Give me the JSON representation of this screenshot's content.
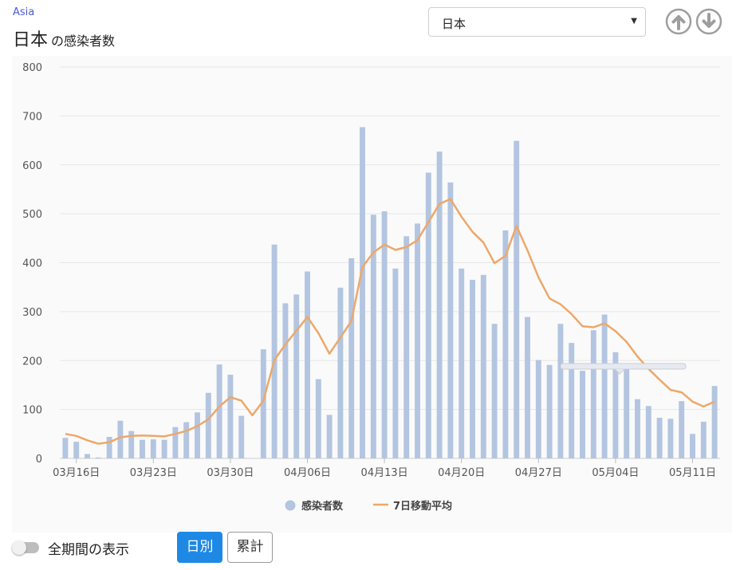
{
  "header": {
    "region": "Asia",
    "title": "日本",
    "subtitle": "の感染者数"
  },
  "country_select": {
    "value": "日本"
  },
  "icons": {
    "up": "arrow-up-circle-icon",
    "down": "arrow-down-circle-icon",
    "dropdown": "caret-down-icon"
  },
  "controls": {
    "toggle_label": "全期間の表示",
    "toggle_on": false,
    "daily_label": "日別",
    "cumulative_label": "累計"
  },
  "colors": {
    "bars": "#b3c5e0",
    "line": "#eda86a",
    "accent": "#1e88e5",
    "region": "#4a5bd6"
  },
  "chart_data": {
    "type": "bar",
    "x": [
      "03月15日",
      "03月16日",
      "03月17日",
      "03月18日",
      "03月19日",
      "03月20日",
      "03月21日",
      "03月22日",
      "03月23日",
      "03月24日",
      "03月25日",
      "03月26日",
      "03月27日",
      "03月28日",
      "03月29日",
      "03月30日",
      "03月31日",
      "04月01日",
      "04月02日",
      "04月03日",
      "04月04日",
      "04月05日",
      "04月06日",
      "04月07日",
      "04月08日",
      "04月09日",
      "04月10日",
      "04月11日",
      "04月12日",
      "04月13日",
      "04月14日",
      "04月15日",
      "04月16日",
      "04月17日",
      "04月18日",
      "04月19日",
      "04月20日",
      "04月21日",
      "04月22日",
      "04月23日",
      "04月24日",
      "04月25日",
      "04月26日",
      "04月27日",
      "04月28日",
      "04月29日",
      "04月30日",
      "05月01日",
      "05月02日",
      "05月03日",
      "05月04日",
      "05月05日",
      "05月06日",
      "05月07日",
      "05月08日",
      "05月09日",
      "05月10日",
      "05月11日",
      "05月12日",
      "05月13日"
    ],
    "x_ticks": [
      "03月16日",
      "03月23日",
      "03月30日",
      "04月06日",
      "04月13日",
      "04月20日",
      "04月27日",
      "05月04日",
      "05月11日"
    ],
    "series": [
      {
        "name": "感染者数",
        "kind": "bar",
        "values": [
          42,
          34,
          9,
          2,
          44,
          77,
          56,
          38,
          39,
          38,
          64,
          74,
          94,
          134,
          192,
          171,
          87,
          0,
          223,
          437,
          317,
          335,
          382,
          162,
          89,
          349,
          409,
          677,
          498,
          505,
          388,
          454,
          480,
          584,
          627,
          564,
          388,
          365,
          375,
          275,
          466,
          649,
          289,
          201,
          191,
          275,
          236,
          179,
          262,
          294,
          217,
          185,
          121,
          107,
          83,
          81,
          117,
          50,
          75,
          148
        ]
      },
      {
        "name": "7日移動平均",
        "kind": "line",
        "values": [
          50,
          46,
          37,
          30,
          33,
          43,
          46,
          47,
          46,
          45,
          50,
          56,
          66,
          80,
          106,
          125,
          118,
          88,
          118,
          201,
          233,
          261,
          289,
          256,
          214,
          247,
          281,
          391,
          421,
          437,
          426,
          432,
          446,
          483,
          520,
          530,
          494,
          463,
          441,
          399,
          414,
          475,
          425,
          370,
          327,
          315,
          295,
          270,
          268,
          276,
          260,
          238,
          208,
          183,
          161,
          140,
          135,
          116,
          106,
          116
        ]
      }
    ],
    "ylim": [
      0,
      800
    ],
    "yticks": [
      0,
      100,
      200,
      300,
      400,
      500,
      600,
      700,
      800
    ],
    "grid": true,
    "legend": "bottom-center"
  }
}
